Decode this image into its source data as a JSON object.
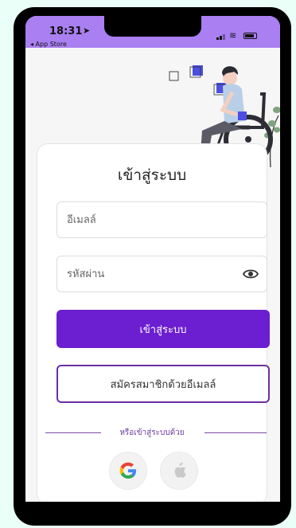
{
  "status_bar": {
    "time": "18:31",
    "location_arrow": "➤",
    "back_label": "◂ App Store",
    "wifi_glyph": "≋"
  },
  "login": {
    "title": "เข้าสู่ระบบ",
    "email_placeholder": "อีเมลล์",
    "email_value": "",
    "password_placeholder": "รหัสผ่าน",
    "password_value": "",
    "login_button": "เข้าสู่ระบบ",
    "register_button": "สมัครสมาชิกด้วยอีเมลล์",
    "divider_text": "หรือเข้าสู่ระบบด้วย"
  },
  "icons": {
    "eye": "eye-icon",
    "google": "google-logo-icon",
    "apple": "apple-logo-icon"
  },
  "colors": {
    "status_bar": "#a97ff2",
    "primary": "#6c1ed1",
    "outline": "#6a2fa3",
    "background": "#eafff8"
  }
}
